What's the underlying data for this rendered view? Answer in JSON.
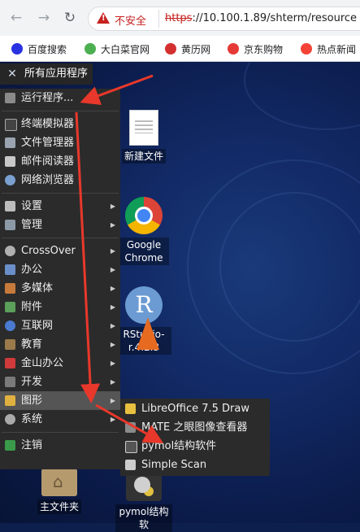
{
  "browser": {
    "insecure_label": "不安全",
    "url_scheme": "https",
    "url_rest": "://10.100.1.89/shterm/resource",
    "bookmarks": [
      {
        "label": "百度搜索",
        "color": "#2932e1"
      },
      {
        "label": "大白菜官网",
        "color": "#4caf50"
      },
      {
        "label": "黄历网",
        "color": "#d32f2f"
      },
      {
        "label": "京东购物",
        "color": "#e53935"
      },
      {
        "label": "热点新闻",
        "color": "#f44336"
      }
    ]
  },
  "desktop": {
    "icons": [
      {
        "label": "新建文件"
      },
      {
        "label": "Google Chrome"
      },
      {
        "label": "RStudio-r.4.2.3"
      },
      {
        "label": "主文件夹"
      },
      {
        "label": "pymol结构软"
      }
    ]
  },
  "appmenu": {
    "title": "所有应用程序"
  },
  "mainmenu": {
    "run": "运行程序...",
    "apps": [
      "终端模拟器",
      "文件管理器",
      "邮件阅读器",
      "网络浏览器"
    ],
    "settings": [
      "设置",
      "管理"
    ],
    "categories": [
      "CrossOver",
      "办公",
      "多媒体",
      "附件",
      "互联网",
      "教育",
      "金山办公",
      "开发",
      "图形",
      "系统"
    ],
    "logout": "注销"
  },
  "submenu": {
    "items": [
      "LibreOffice 7.5 Draw",
      "MATE 之眼图像查看器",
      "pymol结构软件",
      "Simple Scan"
    ]
  },
  "colors": {
    "arrow": "#e8382b",
    "menu_bg": "#2b2b2b",
    "highlight": "#555555"
  }
}
